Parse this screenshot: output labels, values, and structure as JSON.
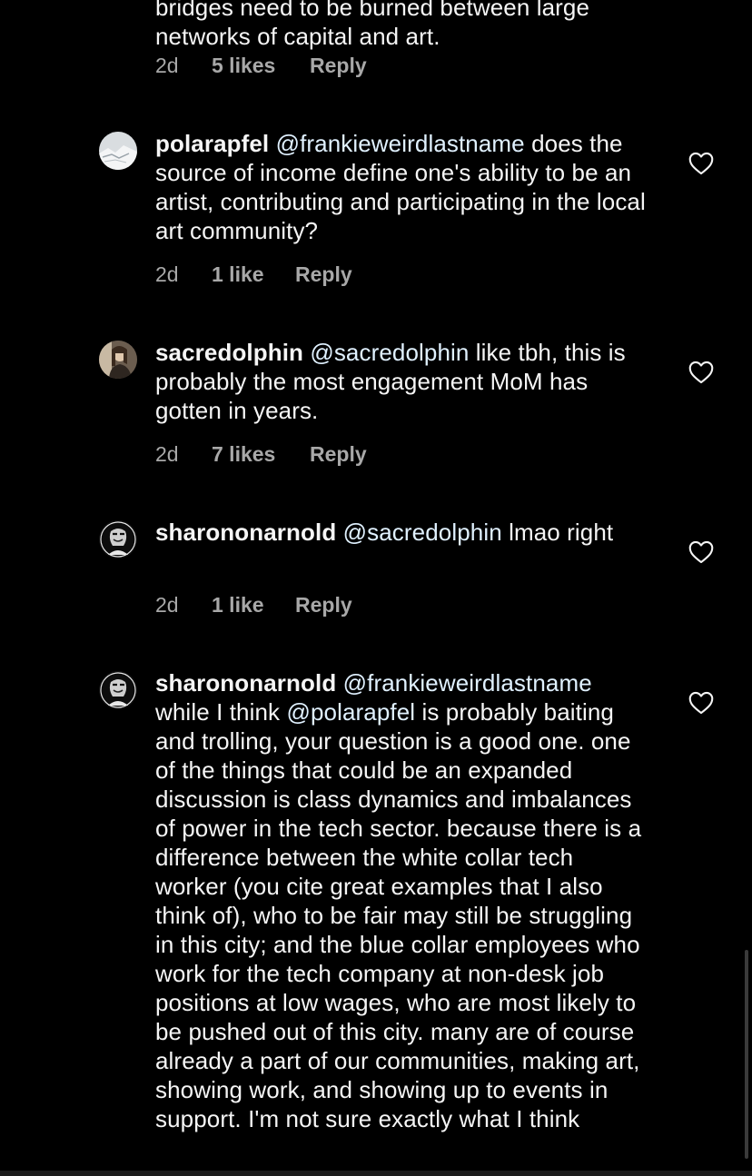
{
  "comments": [
    {
      "username": "",
      "text_lines": [
        "bridges need to be burned between large",
        "networks of capital and art."
      ],
      "time": "2d",
      "likes": "5 likes",
      "reply": "Reply"
    },
    {
      "username": "polarapfel",
      "mention": "@frankieweirdlastname",
      "text_after_mention": " does the source of income define one's ability to be an artist, contributing and participating in the local art community?",
      "time": "2d",
      "likes": "1 like",
      "reply": "Reply",
      "avatar_icon": "snow-landscape-avatar"
    },
    {
      "username": "sacredolphin",
      "mention": "@sacredolphin",
      "text_after_mention": " like tbh, this is probably the most engagement MoM has gotten in years.",
      "time": "2d",
      "likes": "7 likes",
      "reply": "Reply",
      "avatar_icon": "portrait-avatar"
    },
    {
      "username": "sharononarnold",
      "mention": "@sacredolphin",
      "text_after_mention": " lmao right",
      "time": "2d",
      "likes": "1 like",
      "reply": "Reply",
      "avatar_icon": "bw-portrait-avatar"
    },
    {
      "username": "sharononarnold",
      "mention": "@frankieweirdlastname",
      "text_mid": " while I think ",
      "mention2": "@polarapfel",
      "text_after_mention": " is probably baiting and trolling, your question is a good one. one of the things that could be an expanded discussion is class dynamics and imbalances of power in the tech sector. because there is a difference between the white collar tech worker (you cite great examples that I also think of), who to be fair may still be struggling in this city; and the blue collar employees who work for the tech company at non-desk job positions at low wages, who are most likely to be pushed out of this city. many are of course already a part of our communities, making art, showing work, and showing up to events in support. I'm not sure exactly what I think",
      "avatar_icon": "bw-portrait-avatar"
    }
  ],
  "colors": {
    "background": "#000000",
    "text": "#f5f5f5",
    "meta": "#a8a8a8",
    "mention": "#e0f1ff"
  },
  "icons": {
    "like": "heart-outline-icon"
  }
}
